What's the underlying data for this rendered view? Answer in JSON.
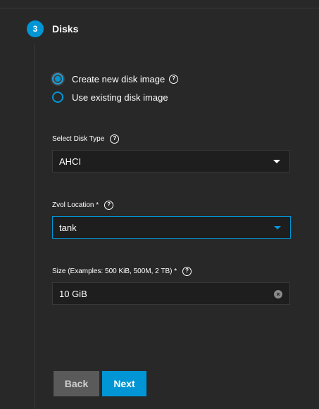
{
  "step": {
    "number": "3",
    "title": "Disks"
  },
  "disk_image_options": [
    {
      "label": "Create new disk image",
      "selected": true
    },
    {
      "label": "Use existing disk image",
      "selected": false
    }
  ],
  "disk_type": {
    "label": "Select Disk Type",
    "value": "AHCI"
  },
  "zvol_location": {
    "label": "Zvol Location *",
    "value": "tank"
  },
  "size": {
    "label": "Size (Examples: 500 KiB, 500M, 2 TB) *",
    "value": "10 GiB"
  },
  "buttons": {
    "back": "Back",
    "next": "Next"
  },
  "icons": {
    "help": "?",
    "clear": "×"
  },
  "colors": {
    "accent": "#0095d5",
    "background": "#282828",
    "field_background": "#1e1e1e",
    "back_button": "#5a5a5a"
  }
}
